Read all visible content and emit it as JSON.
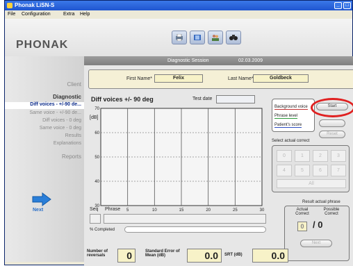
{
  "window": {
    "title": "Phonak LiSN-S"
  },
  "menu": {
    "file": "File",
    "configuration": "Configuration",
    "extra": "Extra",
    "help": "Help"
  },
  "brand": {
    "logo": "PHONAK"
  },
  "toolbar": [
    "printer-icon",
    "notebook-icon",
    "people-icon",
    "binoculars-icon"
  ],
  "sidebar": {
    "client": "Client",
    "diagnostic": "Diagnostic",
    "items": [
      "Diff voices - +/-90 de...",
      "Same voice - +/-90 de...",
      "Diff voices - 0 deg",
      "Same voice - 0 deg",
      "Results",
      "Explanations"
    ],
    "reports": "Reports",
    "next": "Next"
  },
  "session": {
    "title": "Diagnostic Session",
    "date": "02.03.2009"
  },
  "patient": {
    "first_label": "First Name*",
    "first_value": "Felix",
    "last_label": "Last Name*",
    "last_value": "Goldbeck"
  },
  "chart_meta": {
    "title": "Diff voices +/- 90 deg",
    "test_date_label": "Test date",
    "unit": "[dB]",
    "seq_label": "Seq",
    "phrase_label": "Phrase",
    "completed_label": "% Completed"
  },
  "chart_data": {
    "type": "line",
    "title": "Diff voices +/- 90 deg",
    "ylabel": "[dB]",
    "xlim": [
      0,
      30
    ],
    "ylim": [
      30,
      70
    ],
    "x_ticks": [
      "5",
      "10",
      "15",
      "20",
      "25",
      "30"
    ],
    "y_ticks": [
      "70",
      "60",
      "50",
      "40",
      "30"
    ],
    "series": [],
    "grid": true
  },
  "legend": {
    "background": "Background voice",
    "phrase": "Phrase level",
    "score": "Patient's score"
  },
  "controls": {
    "start": "Start",
    "reset": "Reset",
    "next": "Next",
    "select_label": "Select actual correct",
    "all": "All",
    "result_label": "Result actual phrase",
    "actual_label": "Actual Correct",
    "possible_label": "Possible Correct",
    "actual_value": "0",
    "possible_value": "/ 0"
  },
  "number_pad": [
    "0",
    "1",
    "2",
    "3",
    "4",
    "5",
    "6",
    "7"
  ],
  "stats": {
    "reversals_label": "Number of reversals",
    "reversals_value": "0",
    "sem_label": "Standard Error of Mean (dB)",
    "sem_value": "0.0",
    "srt_label": "SRT (dB)",
    "srt_value": "0.0"
  }
}
